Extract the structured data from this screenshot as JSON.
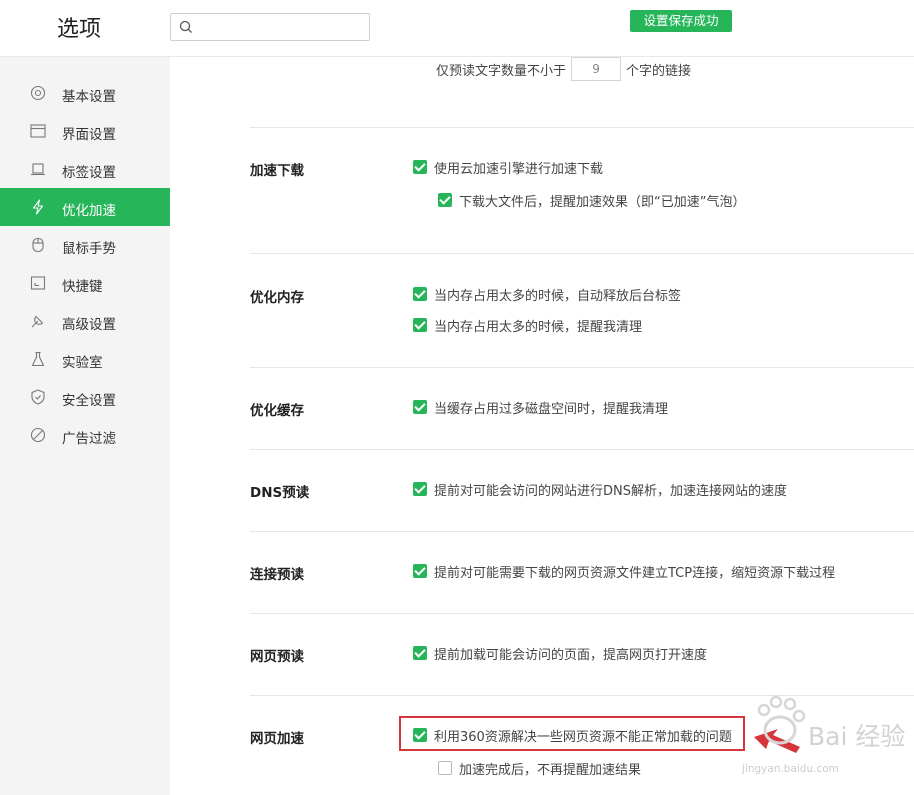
{
  "header": {
    "title": "选项",
    "search_placeholder": "",
    "toast": "设置保存成功"
  },
  "sidebar": {
    "items": [
      {
        "label": "基本设置",
        "icon": "basic-settings-icon",
        "active": false
      },
      {
        "label": "界面设置",
        "icon": "interface-icon",
        "active": false
      },
      {
        "label": "标签设置",
        "icon": "tab-icon",
        "active": false
      },
      {
        "label": "优化加速",
        "icon": "lightning-icon",
        "active": true
      },
      {
        "label": "鼠标手势",
        "icon": "mouse-icon",
        "active": false
      },
      {
        "label": "快捷键",
        "icon": "keyboard-icon",
        "active": false
      },
      {
        "label": "高级设置",
        "icon": "wrench-icon",
        "active": false
      },
      {
        "label": "实验室",
        "icon": "flask-icon",
        "active": false
      },
      {
        "label": "安全设置",
        "icon": "shield-icon",
        "active": false
      },
      {
        "label": "广告过滤",
        "icon": "block-icon",
        "active": false
      }
    ]
  },
  "preread": {
    "prefix": "仅预读文字数量不小于",
    "value": "9",
    "suffix": "个字的链接"
  },
  "sections": {
    "download": {
      "title": "加速下载",
      "opt1": "使用云加速引擎进行加速下载",
      "opt2": "下载大文件后，提醒加速效果（即“已加速”气泡）"
    },
    "memory": {
      "title": "优化内存",
      "opt1": "当内存占用太多的时候，自动释放后台标签",
      "opt2": "当内存占用太多的时候，提醒我清理"
    },
    "cache": {
      "title": "优化缓存",
      "opt1": "当缓存占用过多磁盘空间时，提醒我清理"
    },
    "dns": {
      "title": "DNS预读",
      "opt1": "提前对可能会访问的网站进行DNS解析，加速连接网站的速度"
    },
    "connect": {
      "title": "连接预读",
      "opt1": "提前对可能需要下载的网页资源文件建立TCP连接，缩短资源下载过程"
    },
    "page": {
      "title": "网页预读",
      "opt1": "提前加载可能会访问的页面，提高网页打开速度"
    },
    "web_accel": {
      "title": "网页加速",
      "opt1": "利用360资源解决一些网页资源不能正常加载的问题",
      "opt2": "加速完成后，不再提醒加速结果"
    }
  },
  "watermark": {
    "text": "Bai 经验",
    "sub": "jingyan.baidu.com"
  },
  "colors": {
    "accent": "#27b55a",
    "highlight": "#d6353b",
    "sidebar_bg": "#f4f4f4"
  }
}
